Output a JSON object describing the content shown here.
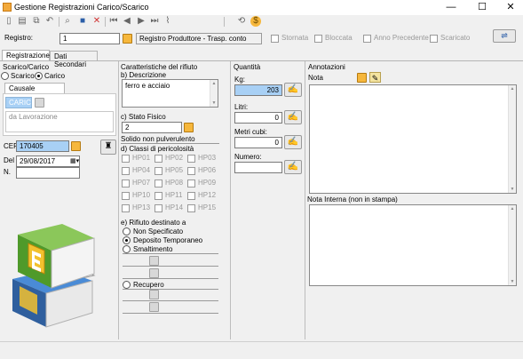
{
  "window": {
    "title": "Gestione Registrazioni Carico/Scarico",
    "minimize": "—",
    "maximize": "☐",
    "close": "✕"
  },
  "header": {
    "registro_label": "Registro:",
    "registro_value": "1",
    "registro_desc": "Registro Produttore - Trasp. conto",
    "checks": [
      {
        "label": "Stornata",
        "checked": false
      },
      {
        "label": "Bloccata",
        "checked": false
      },
      {
        "label": "Anno Precedente",
        "checked": false
      },
      {
        "label": "Scaricato",
        "checked": false
      }
    ]
  },
  "tabs": [
    {
      "label": "Registrazione",
      "active": true
    },
    {
      "label": "Dati Secondari",
      "active": false
    }
  ],
  "scarico_carico": {
    "title": "Scarico/Carico",
    "options": [
      {
        "label": "Scarico",
        "selected": false
      },
      {
        "label": "Carico",
        "selected": true
      }
    ],
    "causale_tab": "Causale Registro",
    "causale_value": "CARICO",
    "causale_desc": "da Lavorazione",
    "cer_label": "CER",
    "cer_value": "170405",
    "del_label": "Del",
    "del_value": "29/08/2017",
    "n_label": "N.",
    "n_value": ""
  },
  "caratteristiche": {
    "title": "Caratteristiche del rifiuto",
    "descrizione_label": "b) Descrizione",
    "descrizione_value": "ferro e acciaio",
    "stato_label": "c) Stato Fisico",
    "stato_value": "2",
    "stato_desc": "Solido non pulverulento",
    "classi_label": "d) Classi di pericolosità",
    "classi": [
      "HP01",
      "HP02",
      "HP03",
      "HP04",
      "HP05",
      "HP06",
      "HP07",
      "HP08",
      "HP09",
      "HP10",
      "HP11",
      "HP12",
      "HP13",
      "HP14",
      "HP15"
    ],
    "destinato_label": "e) Rifiuto destinato a",
    "destinato_options": [
      {
        "label": "Non Specificato",
        "selected": false
      },
      {
        "label": "Deposito Temporaneo",
        "selected": true
      },
      {
        "label": "Smaltimento",
        "selected": false
      },
      {
        "label": "Recupero",
        "selected": false
      }
    ]
  },
  "quantita": {
    "title": "Quantità",
    "kg_label": "Kg:",
    "kg_value": "203",
    "litri_label": "Litri:",
    "litri_value": "0",
    "metri_label": "Metri cubi:",
    "metri_value": "0",
    "numero_label": "Numero:",
    "numero_value": ""
  },
  "annotazioni": {
    "title": "Annotazioni",
    "nota_label": "Nota",
    "nota_interna_label": "Nota Interna (non in stampa)"
  },
  "colors": {
    "accent_blue": "#a8d0f5",
    "button_orange": "#f6b73c"
  }
}
